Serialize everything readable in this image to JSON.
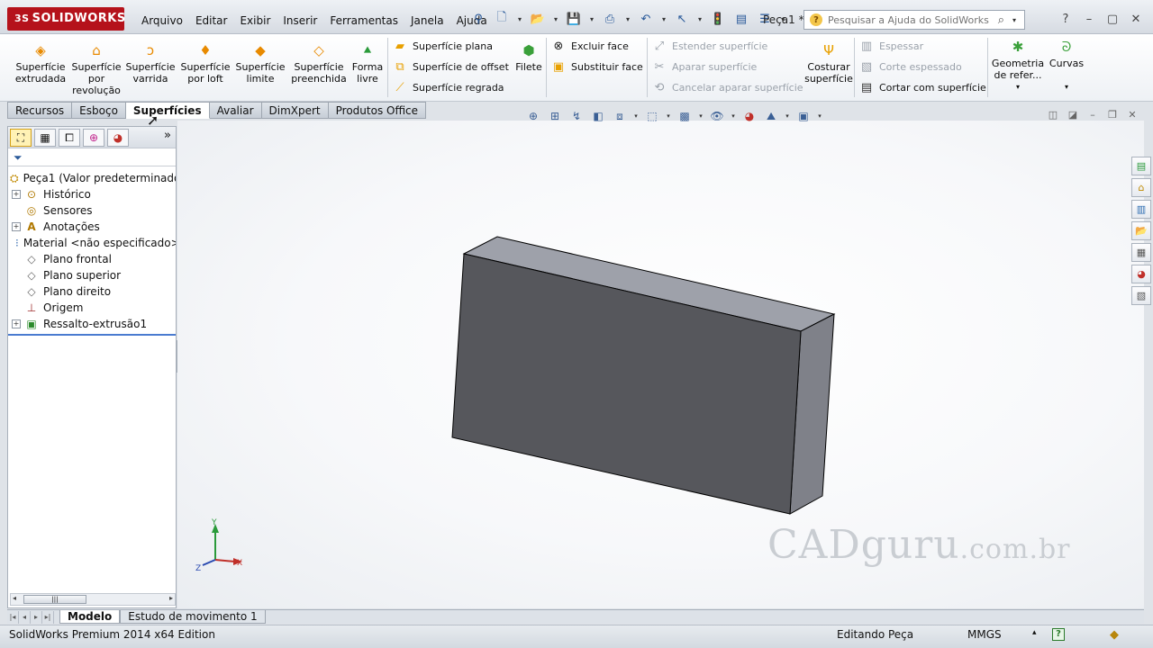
{
  "app": {
    "logo_prefix": "3S",
    "logo_text": "SOLIDWORKS",
    "doc_title": "Peça1 *"
  },
  "menu": [
    "Arquivo",
    "Editar",
    "Exibir",
    "Inserir",
    "Ferramentas",
    "Janela",
    "Ajuda"
  ],
  "help_search": {
    "placeholder": "Pesquisar a Ajuda do SolidWorks"
  },
  "ribbon": {
    "big_buttons": [
      {
        "label": "Superfície extrudada",
        "icon": "extruded-surface-icon"
      },
      {
        "label": "Superfície por revolução",
        "icon": "revolved-surface-icon"
      },
      {
        "label": "Superfície varrida",
        "icon": "swept-surface-icon"
      },
      {
        "label": "Superfície por loft",
        "icon": "lofted-surface-icon"
      },
      {
        "label": "Superfície limite",
        "icon": "boundary-surface-icon"
      },
      {
        "label": "Superfície preenchida",
        "icon": "filled-surface-icon"
      },
      {
        "label": "Forma livre",
        "icon": "freeform-icon"
      }
    ],
    "col1": [
      "Superfície plana",
      "Superfície de offset",
      "Superfície regrada"
    ],
    "fillet": "Filete",
    "col2": [
      "Excluir face",
      "Substituir face"
    ],
    "col3": [
      "Estender superfície",
      "Aparar superfície",
      "Cancelar aparar superfície"
    ],
    "knit": "Costurar superfície",
    "col4": [
      "Espessar",
      "Corte espessado",
      "Cortar com superfície"
    ],
    "ref_geometry": "Geometria de refer...",
    "curves": "Curvas"
  },
  "command_tabs": [
    {
      "label": "Recursos",
      "active": false
    },
    {
      "label": "Esboço",
      "active": false
    },
    {
      "label": "Superfícies",
      "active": true
    },
    {
      "label": "Avaliar",
      "active": false
    },
    {
      "label": "DimXpert",
      "active": false
    },
    {
      "label": "Produtos Office",
      "active": false
    }
  ],
  "tree": {
    "root": "Peça1  (Valor predeterminado<",
    "items": [
      {
        "label": "Histórico",
        "expandable": true
      },
      {
        "label": "Sensores",
        "expandable": false
      },
      {
        "label": "Anotações",
        "expandable": true
      },
      {
        "label": "Material <não especificado>",
        "expandable": false
      },
      {
        "label": "Plano frontal",
        "expandable": false
      },
      {
        "label": "Plano superior",
        "expandable": false
      },
      {
        "label": "Plano direito",
        "expandable": false
      },
      {
        "label": "Origem",
        "expandable": false
      },
      {
        "label": "Ressalto-extrusão1",
        "expandable": true
      }
    ]
  },
  "triad": {
    "x": "X",
    "y": "Y",
    "z": "Z"
  },
  "watermark": {
    "main": "CADguru",
    "tld": ".com.br"
  },
  "bottom_tabs": [
    {
      "label": "Modelo",
      "active": true
    },
    {
      "label": "Estudo de movimento 1",
      "active": false
    }
  ],
  "status": {
    "edition": "SolidWorks Premium 2014 x64 Edition",
    "mode": "Editando Peça",
    "units": "MMGS"
  },
  "colors": {
    "front_face": "#56575c",
    "top_face": "#9ea1aa",
    "side_face": "#7f8189",
    "brand": "#b5121b"
  }
}
